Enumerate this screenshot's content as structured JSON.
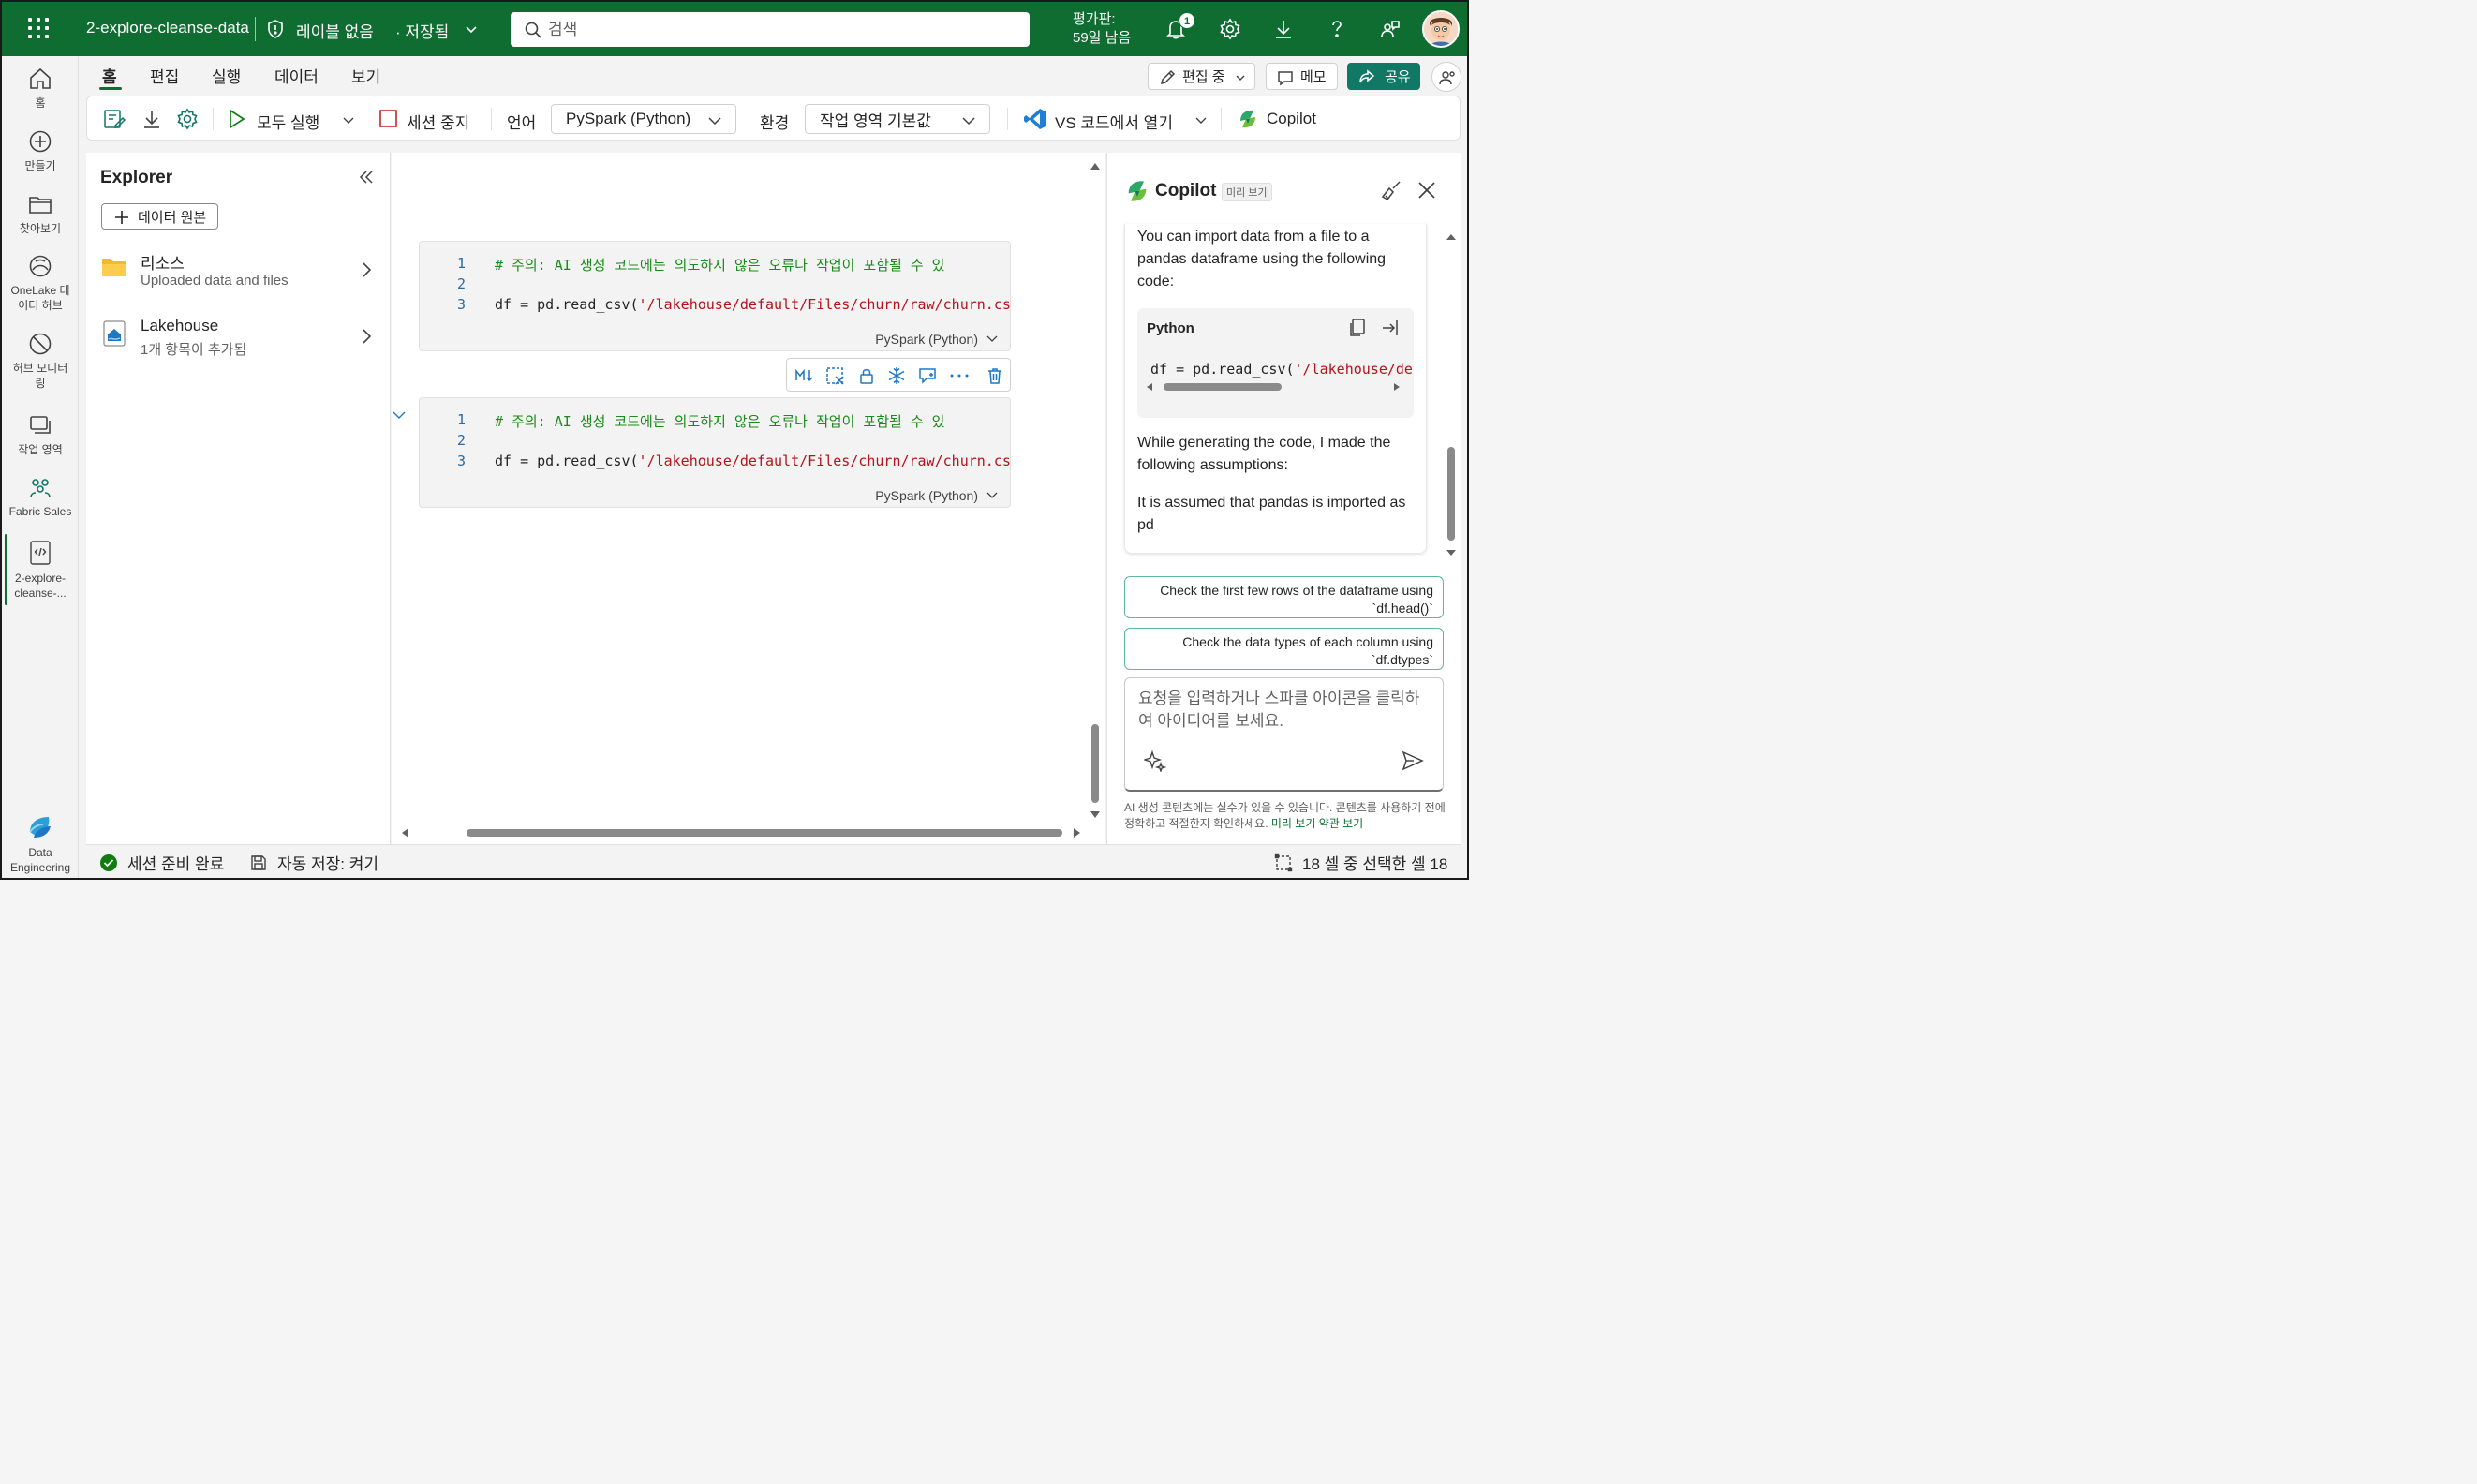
{
  "topbar": {
    "doc_title": "2-explore-cleanse-data",
    "sensitivity_label": "레이블 없음",
    "saved_status": "· 저장됨",
    "search_placeholder": "검색",
    "trial_line1": "평가판:",
    "trial_line2": "59일 남음",
    "notification_count": "1",
    "icons": [
      "app-launcher-icon",
      "shield-icon",
      "chevron-down-icon",
      "search-icon",
      "bell-icon",
      "gear-icon",
      "download-icon",
      "help-icon",
      "share-feedback-icon",
      "avatar"
    ]
  },
  "rail": {
    "items": [
      {
        "label": "홈",
        "icon": "home-icon"
      },
      {
        "label": "만들기",
        "icon": "create-icon"
      },
      {
        "label": "찾아보기",
        "icon": "folder-icon"
      },
      {
        "label": "OneLake 데이터 허브",
        "label_line1": "OneLake 데",
        "label_line2": "이터 허브",
        "icon": "onelake-icon"
      },
      {
        "label": "허브 모니터링",
        "label_line1": "허브 모니터",
        "label_line2": "링",
        "icon": "monitor-icon"
      },
      {
        "label": "작업 영역",
        "icon": "workspaces-icon"
      },
      {
        "label": "Fabric Sales",
        "icon": "workspace-group-icon"
      },
      {
        "label": "2-explore-cleanse-...",
        "label_line1": "2-explore-",
        "label_line2": "cleanse-...",
        "icon": "notebook-icon"
      },
      {
        "label": "Data Engineering",
        "label_line1": "Data",
        "label_line2": "Engineering",
        "icon": "fabric-logo-icon"
      }
    ]
  },
  "ribbon": {
    "tabs": [
      "홈",
      "편집",
      "실행",
      "데이터",
      "보기"
    ],
    "active_tab": "홈",
    "editing_label": "편집 중",
    "memo_label": "메모",
    "share_label": "공유"
  },
  "toolbar": {
    "run_all": "모두 실행",
    "stop_session": "세션 중지",
    "language_label": "언어",
    "language_value": "PySpark (Python)",
    "environment_label": "환경",
    "environment_value": "작업 영역 기본값",
    "vscode_label": "VS 코드에서 열기",
    "copilot_label": "Copilot"
  },
  "explorer": {
    "title": "Explorer",
    "add_source": "데이터 원본",
    "items": [
      {
        "title": "리소스",
        "subtitle": "Uploaded data and files"
      },
      {
        "title": "Lakehouse",
        "subtitle": "1개 항목이 추가됨"
      }
    ]
  },
  "cells": [
    {
      "lines": [
        {
          "n": "1",
          "comment": "# 주의: AI 생성 코드에는 의도하지 않은 오류나 작업이 포함될 수 있"
        },
        {
          "n": "2",
          "code": ""
        },
        {
          "n": "3",
          "prefix": "df = pd.read_csv(",
          "str": "'/lakehouse/default/Files/churn/raw/churn.cs"
        }
      ],
      "language": "PySpark (Python)"
    },
    {
      "lines": [
        {
          "n": "1",
          "comment": "# 주의: AI 생성 코드에는 의도하지 않은 오류나 작업이 포함될 수 있"
        },
        {
          "n": "2",
          "code": ""
        },
        {
          "n": "3",
          "prefix": "df = pd.read_csv(",
          "str": "'/lakehouse/default/Files/churn/raw/churn.cs"
        }
      ],
      "language": "PySpark (Python)"
    }
  ],
  "cell_toolbar_icons": [
    "markdown-toggle-icon",
    "clear-output-icon",
    "lock-icon",
    "freeze-icon",
    "comment-icon",
    "more-icon",
    "delete-icon"
  ],
  "copilot": {
    "title": "Copilot",
    "preview_badge": "미리 보기",
    "message_intro_1": "You can import data from a file to a",
    "message_intro_2": "pandas dataframe using the following",
    "message_intro_3": "code:",
    "code_language": "Python",
    "code_prefix": "df = pd.read_csv(",
    "code_str": "'/lakehouse/defau",
    "assumptions_1": "While generating the code, I made the",
    "assumptions_2": "following assumptions:",
    "assumption_item_1": "It is assumed that pandas is imported as",
    "assumption_item_2": "pd",
    "suggestions": [
      {
        "line1": "Check the first few rows of the dataframe using",
        "line2": "`df.head()`"
      },
      {
        "line1": "Check the data types of each column using",
        "line2": "`df.dtypes`"
      }
    ],
    "input_placeholder": "요청을 입력하거나 스파클 아이콘을 클릭하여 아이디어를 보세요.",
    "disclaimer": "AI 생성 콘텐츠에는 실수가 있을 수 있습니다. 콘텐츠를 사용하기 전에 정확하고 적절한지 확인하세요.",
    "disclaimer_link": "미리 보기 약관 보기"
  },
  "statusbar": {
    "session_status": "세션 준비 완료",
    "autosave": "자동 저장: 켜기",
    "selection": "18 셀 중 선택한 셀 18"
  },
  "colors": {
    "brand": "#0f6d32",
    "share": "#117865",
    "comment": "#1a8a1a",
    "string": "#b5121b",
    "line_number": "#2b6aa3"
  }
}
